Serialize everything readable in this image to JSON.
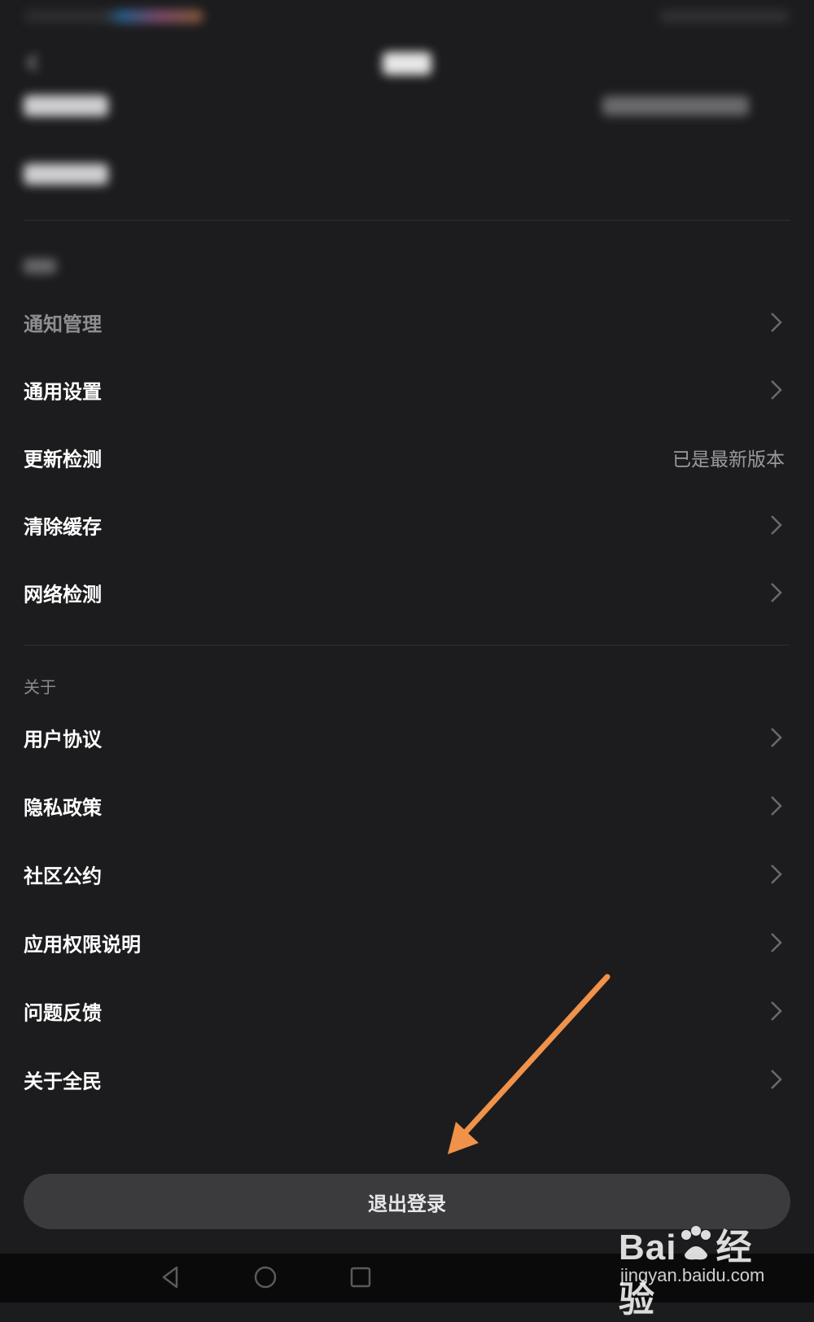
{
  "settings_section": {
    "items": [
      {
        "label": "通知管理",
        "value": ""
      },
      {
        "label": "通用设置",
        "value": ""
      },
      {
        "label": "更新检测",
        "value": "已是最新版本"
      },
      {
        "label": "清除缓存",
        "value": ""
      },
      {
        "label": "网络检测",
        "value": ""
      }
    ]
  },
  "about_section": {
    "header": "关于",
    "items": [
      {
        "label": "用户协议"
      },
      {
        "label": "隐私政策"
      },
      {
        "label": "社区公约"
      },
      {
        "label": "应用权限说明"
      },
      {
        "label": "问题反馈"
      },
      {
        "label": "关于全民"
      }
    ]
  },
  "logout": {
    "label": "退出登录"
  },
  "annotation": {
    "arrow_color": "#f0924a"
  },
  "icons": {
    "back": "back-arrow-icon",
    "chevron": "chevron-right-icon",
    "nav_back": "nav-back-triangle-icon",
    "nav_home": "nav-home-circle-icon",
    "nav_recent": "nav-recent-square-icon"
  },
  "colors": {
    "background": "#1c1c1e",
    "text": "#ffffff",
    "secondary": "#9a9a9e",
    "button": "#3b3b3e"
  },
  "watermark": {
    "brand": "Bai",
    "brand_suffix": "经验",
    "url": "jingyan.baidu.com"
  }
}
